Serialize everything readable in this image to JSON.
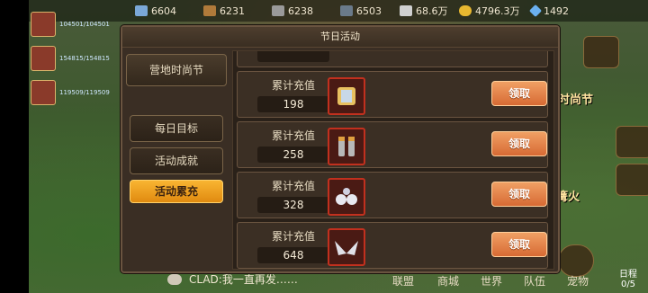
{
  "top_bar": {
    "resources": [
      {
        "icon": "food-icon",
        "value": "6604"
      },
      {
        "icon": "wood-icon",
        "value": "6231"
      },
      {
        "icon": "stone-icon",
        "value": "6238"
      },
      {
        "icon": "iron-icon",
        "value": "6503"
      },
      {
        "icon": "silver-icon",
        "value": "68.6万"
      },
      {
        "icon": "gold-icon",
        "value": "4796.3万"
      },
      {
        "icon": "gem-icon",
        "value": "1492"
      }
    ]
  },
  "roster": [
    {
      "hp": "104501/104501"
    },
    {
      "hp": "154815/154815"
    },
    {
      "hp": "119509/119509"
    }
  ],
  "dialog": {
    "title": "节日活动",
    "tabs": [
      {
        "label": "营地时尚节",
        "active": false
      },
      {
        "label": "每日目标",
        "active": false
      },
      {
        "label": "活动成就",
        "active": false
      },
      {
        "label": "活动累充",
        "active": true
      }
    ],
    "rows": [
      {
        "label": "累计充值",
        "value": "198",
        "item": "armor-icon",
        "button": "领取"
      },
      {
        "label": "累计充值",
        "value": "258",
        "item": "boots-icon",
        "button": "领取"
      },
      {
        "label": "累计充值",
        "value": "328",
        "item": "pets-icon",
        "button": "领取"
      },
      {
        "label": "累计充值",
        "value": "648",
        "item": "wings-icon",
        "button": "领取"
      }
    ]
  },
  "side": {
    "fashion_label": "时尚节",
    "fire_label": "篝火",
    "record_label": "日程",
    "record_count": "0/5"
  },
  "chat": {
    "message": "CLAD:我一直再发……"
  },
  "bottom_nav": [
    "联盟",
    "商城",
    "世界",
    "队伍",
    "宠物"
  ]
}
